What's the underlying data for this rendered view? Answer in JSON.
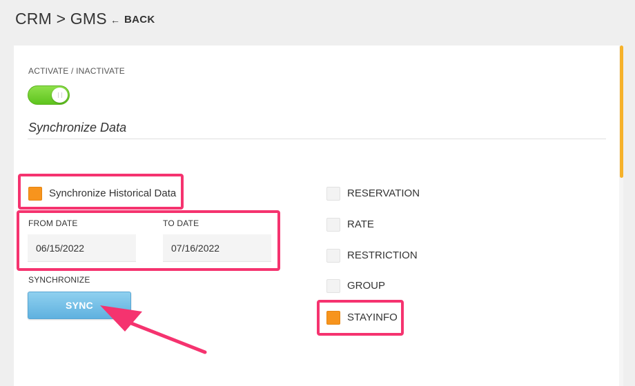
{
  "header": {
    "title": "CRM > GMS",
    "back_label": "BACK"
  },
  "activation": {
    "label": "ACTIVATE / INACTIVATE",
    "enabled": true
  },
  "section": {
    "title": "Synchronize Data"
  },
  "historical": {
    "label": "Synchronize Historical Data",
    "checked": true
  },
  "dates": {
    "from_label": "FROM DATE",
    "from_value": "06/15/2022",
    "to_label": "TO DATE",
    "to_value": "07/16/2022"
  },
  "sync": {
    "label": "SYNCHRONIZE",
    "button_label": "SYNC"
  },
  "options": [
    {
      "label": "RESERVATION",
      "checked": false
    },
    {
      "label": "RATE",
      "checked": false
    },
    {
      "label": "RESTRICTION",
      "checked": false
    },
    {
      "label": "GROUP",
      "checked": false
    },
    {
      "label": "STAYINFO",
      "checked": true
    }
  ],
  "colors": {
    "accent_orange": "#f7941d",
    "highlight_pink": "#f5336f",
    "toggle_green": "#5ec41e",
    "sync_blue": "#5fb1df",
    "scrollbar": "#f6b22a"
  },
  "icons": {
    "back": "arrow-left-icon",
    "toggle": "toggle-switch-icon",
    "annotation": "arrow-pointer-icon"
  }
}
